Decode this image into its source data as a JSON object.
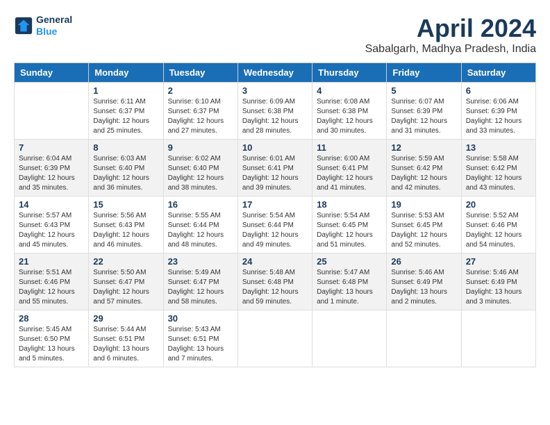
{
  "header": {
    "logo_line1": "General",
    "logo_line2": "Blue",
    "title": "April 2024",
    "subtitle": "Sabalgarh, Madhya Pradesh, India"
  },
  "weekdays": [
    "Sunday",
    "Monday",
    "Tuesday",
    "Wednesday",
    "Thursday",
    "Friday",
    "Saturday"
  ],
  "weeks": [
    {
      "shaded": false,
      "days": [
        {
          "number": "",
          "sunrise": "",
          "sunset": "",
          "daylight": ""
        },
        {
          "number": "1",
          "sunrise": "Sunrise: 6:11 AM",
          "sunset": "Sunset: 6:37 PM",
          "daylight": "Daylight: 12 hours and 25 minutes."
        },
        {
          "number": "2",
          "sunrise": "Sunrise: 6:10 AM",
          "sunset": "Sunset: 6:37 PM",
          "daylight": "Daylight: 12 hours and 27 minutes."
        },
        {
          "number": "3",
          "sunrise": "Sunrise: 6:09 AM",
          "sunset": "Sunset: 6:38 PM",
          "daylight": "Daylight: 12 hours and 28 minutes."
        },
        {
          "number": "4",
          "sunrise": "Sunrise: 6:08 AM",
          "sunset": "Sunset: 6:38 PM",
          "daylight": "Daylight: 12 hours and 30 minutes."
        },
        {
          "number": "5",
          "sunrise": "Sunrise: 6:07 AM",
          "sunset": "Sunset: 6:39 PM",
          "daylight": "Daylight: 12 hours and 31 minutes."
        },
        {
          "number": "6",
          "sunrise": "Sunrise: 6:06 AM",
          "sunset": "Sunset: 6:39 PM",
          "daylight": "Daylight: 12 hours and 33 minutes."
        }
      ]
    },
    {
      "shaded": true,
      "days": [
        {
          "number": "7",
          "sunrise": "Sunrise: 6:04 AM",
          "sunset": "Sunset: 6:39 PM",
          "daylight": "Daylight: 12 hours and 35 minutes."
        },
        {
          "number": "8",
          "sunrise": "Sunrise: 6:03 AM",
          "sunset": "Sunset: 6:40 PM",
          "daylight": "Daylight: 12 hours and 36 minutes."
        },
        {
          "number": "9",
          "sunrise": "Sunrise: 6:02 AM",
          "sunset": "Sunset: 6:40 PM",
          "daylight": "Daylight: 12 hours and 38 minutes."
        },
        {
          "number": "10",
          "sunrise": "Sunrise: 6:01 AM",
          "sunset": "Sunset: 6:41 PM",
          "daylight": "Daylight: 12 hours and 39 minutes."
        },
        {
          "number": "11",
          "sunrise": "Sunrise: 6:00 AM",
          "sunset": "Sunset: 6:41 PM",
          "daylight": "Daylight: 12 hours and 41 minutes."
        },
        {
          "number": "12",
          "sunrise": "Sunrise: 5:59 AM",
          "sunset": "Sunset: 6:42 PM",
          "daylight": "Daylight: 12 hours and 42 minutes."
        },
        {
          "number": "13",
          "sunrise": "Sunrise: 5:58 AM",
          "sunset": "Sunset: 6:42 PM",
          "daylight": "Daylight: 12 hours and 43 minutes."
        }
      ]
    },
    {
      "shaded": false,
      "days": [
        {
          "number": "14",
          "sunrise": "Sunrise: 5:57 AM",
          "sunset": "Sunset: 6:43 PM",
          "daylight": "Daylight: 12 hours and 45 minutes."
        },
        {
          "number": "15",
          "sunrise": "Sunrise: 5:56 AM",
          "sunset": "Sunset: 6:43 PM",
          "daylight": "Daylight: 12 hours and 46 minutes."
        },
        {
          "number": "16",
          "sunrise": "Sunrise: 5:55 AM",
          "sunset": "Sunset: 6:44 PM",
          "daylight": "Daylight: 12 hours and 48 minutes."
        },
        {
          "number": "17",
          "sunrise": "Sunrise: 5:54 AM",
          "sunset": "Sunset: 6:44 PM",
          "daylight": "Daylight: 12 hours and 49 minutes."
        },
        {
          "number": "18",
          "sunrise": "Sunrise: 5:54 AM",
          "sunset": "Sunset: 6:45 PM",
          "daylight": "Daylight: 12 hours and 51 minutes."
        },
        {
          "number": "19",
          "sunrise": "Sunrise: 5:53 AM",
          "sunset": "Sunset: 6:45 PM",
          "daylight": "Daylight: 12 hours and 52 minutes."
        },
        {
          "number": "20",
          "sunrise": "Sunrise: 5:52 AM",
          "sunset": "Sunset: 6:46 PM",
          "daylight": "Daylight: 12 hours and 54 minutes."
        }
      ]
    },
    {
      "shaded": true,
      "days": [
        {
          "number": "21",
          "sunrise": "Sunrise: 5:51 AM",
          "sunset": "Sunset: 6:46 PM",
          "daylight": "Daylight: 12 hours and 55 minutes."
        },
        {
          "number": "22",
          "sunrise": "Sunrise: 5:50 AM",
          "sunset": "Sunset: 6:47 PM",
          "daylight": "Daylight: 12 hours and 57 minutes."
        },
        {
          "number": "23",
          "sunrise": "Sunrise: 5:49 AM",
          "sunset": "Sunset: 6:47 PM",
          "daylight": "Daylight: 12 hours and 58 minutes."
        },
        {
          "number": "24",
          "sunrise": "Sunrise: 5:48 AM",
          "sunset": "Sunset: 6:48 PM",
          "daylight": "Daylight: 12 hours and 59 minutes."
        },
        {
          "number": "25",
          "sunrise": "Sunrise: 5:47 AM",
          "sunset": "Sunset: 6:48 PM",
          "daylight": "Daylight: 13 hours and 1 minute."
        },
        {
          "number": "26",
          "sunrise": "Sunrise: 5:46 AM",
          "sunset": "Sunset: 6:49 PM",
          "daylight": "Daylight: 13 hours and 2 minutes."
        },
        {
          "number": "27",
          "sunrise": "Sunrise: 5:46 AM",
          "sunset": "Sunset: 6:49 PM",
          "daylight": "Daylight: 13 hours and 3 minutes."
        }
      ]
    },
    {
      "shaded": false,
      "days": [
        {
          "number": "28",
          "sunrise": "Sunrise: 5:45 AM",
          "sunset": "Sunset: 6:50 PM",
          "daylight": "Daylight: 13 hours and 5 minutes."
        },
        {
          "number": "29",
          "sunrise": "Sunrise: 5:44 AM",
          "sunset": "Sunset: 6:51 PM",
          "daylight": "Daylight: 13 hours and 6 minutes."
        },
        {
          "number": "30",
          "sunrise": "Sunrise: 5:43 AM",
          "sunset": "Sunset: 6:51 PM",
          "daylight": "Daylight: 13 hours and 7 minutes."
        },
        {
          "number": "",
          "sunrise": "",
          "sunset": "",
          "daylight": ""
        },
        {
          "number": "",
          "sunrise": "",
          "sunset": "",
          "daylight": ""
        },
        {
          "number": "",
          "sunrise": "",
          "sunset": "",
          "daylight": ""
        },
        {
          "number": "",
          "sunrise": "",
          "sunset": "",
          "daylight": ""
        }
      ]
    }
  ]
}
